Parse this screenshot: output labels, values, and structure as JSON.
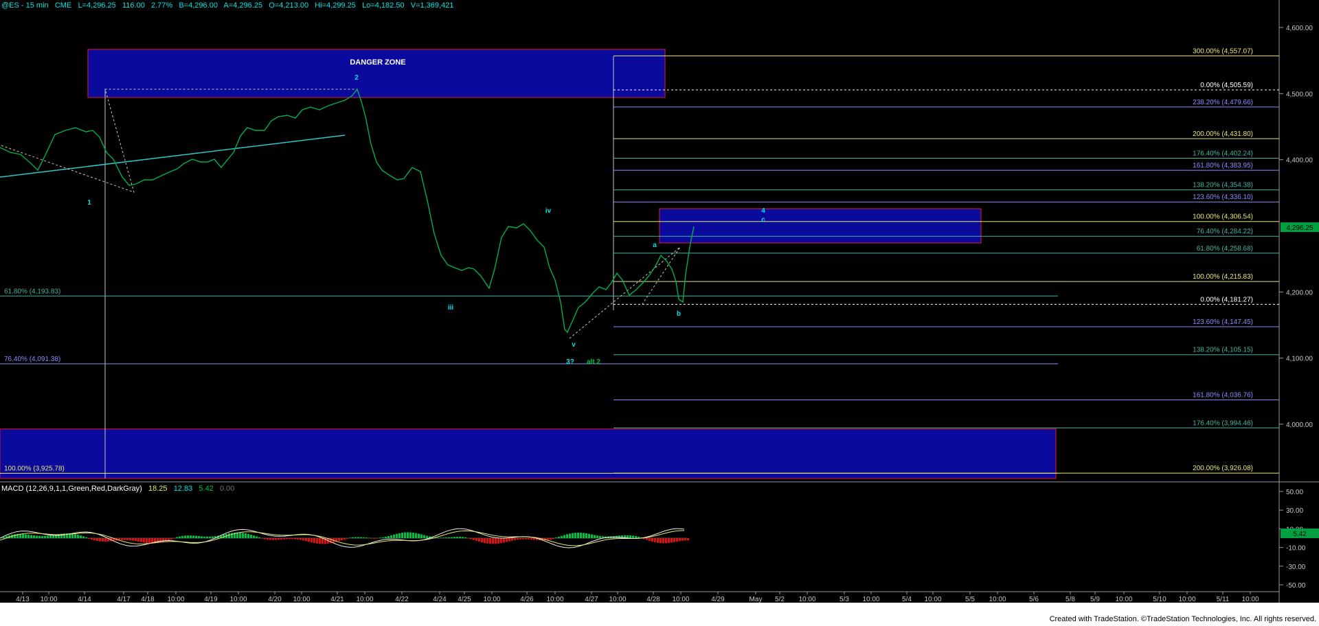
{
  "header": {
    "symbol": "@ES - 15 min",
    "exchange": "CME",
    "last": "L=4,296.25",
    "change": "116.00",
    "change_pct": "2.77%",
    "bid": "B=4,296.00",
    "ask": "A=4,296.25",
    "open": "O=4,213.00",
    "high": "Hi=4,299.25",
    "low": "Lo=4,182.50",
    "volume": "V=1,369,421"
  },
  "price_axis": {
    "labels": [
      "4,600.00",
      "4,500.00",
      "4,400.00",
      "4,200.00",
      "4,100.00",
      "4,000.00"
    ],
    "current_tag": "4,296.25"
  },
  "macd": {
    "label": "MACD (12,26,9,1,1,Green,Red,DarkGray)",
    "value1": "18.25",
    "value2": "12.83",
    "value3": "5.42",
    "value4": "0.00",
    "axis_labels": [
      "50.00",
      "30.00",
      "10.00",
      "-10.00",
      "-30.00",
      "-50.00"
    ],
    "current_tag": "5.42"
  },
  "zones": {
    "danger": "DANGER ZONE"
  },
  "fib_left": [
    {
      "label": "61.80% (4,193.83)",
      "color": "#46b4a0"
    },
    {
      "label": "76.40% (4,091.38)",
      "color": "#8c8cff"
    },
    {
      "label": "100.00% (3,925.78)",
      "color": "#e8e870"
    }
  ],
  "fib_right": [
    {
      "label": "300.00% (4,557.07)",
      "color": "#e8e870"
    },
    {
      "label": "0.00% (4,505.59)",
      "color": "#ffffff"
    },
    {
      "label": "238.20% (4,479.66)",
      "color": "#8c8cff"
    },
    {
      "label": "200.00% (4,431.80)",
      "color": "#e8e870"
    },
    {
      "label": "176.40% (4,402.24)",
      "color": "#46b4a0"
    },
    {
      "label": "161.80% (4,383.95)",
      "color": "#8c8cff"
    },
    {
      "label": "138.20% (4,354.38)",
      "color": "#46b4a0"
    },
    {
      "label": "123.60% (4,336.10)",
      "color": "#8c8cff"
    },
    {
      "label": "100.00% (4,306.54)",
      "color": "#e8e870"
    },
    {
      "label": "76.40% (4,284.22)",
      "color": "#46b4a0"
    },
    {
      "label": "61.80% (4,258.68)",
      "color": "#46b4a0"
    },
    {
      "label": "100.00% (4,215.83)",
      "color": "#e8e870"
    },
    {
      "label": "0.00% (4,181.27)",
      "color": "#ffffff"
    },
    {
      "label": "123.60% (4,147.45)",
      "color": "#8c8cff"
    },
    {
      "label": "138.20% (4,105.15)",
      "color": "#46b4a0"
    },
    {
      "label": "161.80% (4,036.76)",
      "color": "#8c8cff"
    },
    {
      "label": "176.40% (3,994.46)",
      "color": "#46b4a0"
    },
    {
      "label": "200.00% (3,926.08)",
      "color": "#e8e870"
    }
  ],
  "wave_labels": [
    "1",
    "2",
    "iii",
    "iv",
    "v",
    "3?",
    "alt 2",
    "a",
    "b",
    "4",
    "c"
  ],
  "x_axis": [
    "4/13",
    "10:00",
    "4/14",
    "4/17",
    "4/18",
    "10:00",
    "4/19",
    "10:00",
    "4/20",
    "10:00",
    "4/21",
    "10:00",
    "4/22",
    "4/24",
    "4/25",
    "10:00",
    "4/26",
    "10:00",
    "4/27",
    "10:00",
    "4/28",
    "10:00",
    "4/29",
    "May",
    "5/2",
    "10:00",
    "5/3",
    "10:00",
    "5/4",
    "10:00",
    "5/5",
    "10:00",
    "5/6",
    "5/8",
    "5/9",
    "10:00",
    "5/10",
    "10:00",
    "5/11",
    "10:00"
  ],
  "footer": "Created with TradeStation. ©TradeStation Technologies, Inc. All rights reserved.",
  "colors": {
    "background": "#000000",
    "price_line": "#00b050",
    "macd_pos": "#00c040",
    "macd_neg": "#e01010",
    "zone_fill": "#0a0a9c",
    "zone_border": "#c0143c"
  }
}
